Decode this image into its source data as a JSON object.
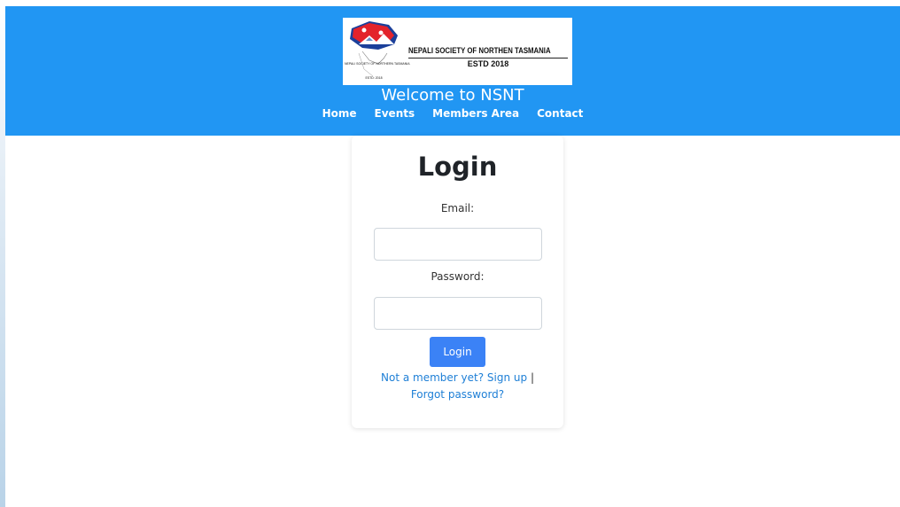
{
  "header": {
    "logo": {
      "org_name": "NEPALI SOCIETY OF NORTHEN TASMANIA",
      "estd": "ESTD 2018",
      "small_caption": "NEPALI SOCIETY OF NORTHERN TASMANIA",
      "tiny_caption": "ESTD: 2018"
    },
    "welcome": "Welcome to NSNT",
    "nav": [
      "Home",
      "Events",
      "Members Area",
      "Contact"
    ]
  },
  "login": {
    "title": "Login",
    "email_label": "Email:",
    "email_value": "",
    "password_label": "Password:",
    "password_value": "",
    "button_label": "Login",
    "signup_link": "Not a member yet? Sign up",
    "separator": "|",
    "forgot_link": "Forgot password?"
  },
  "colors": {
    "header_bg": "#2196f3",
    "button_bg": "#3b82f6",
    "link": "#1e7fd6"
  }
}
